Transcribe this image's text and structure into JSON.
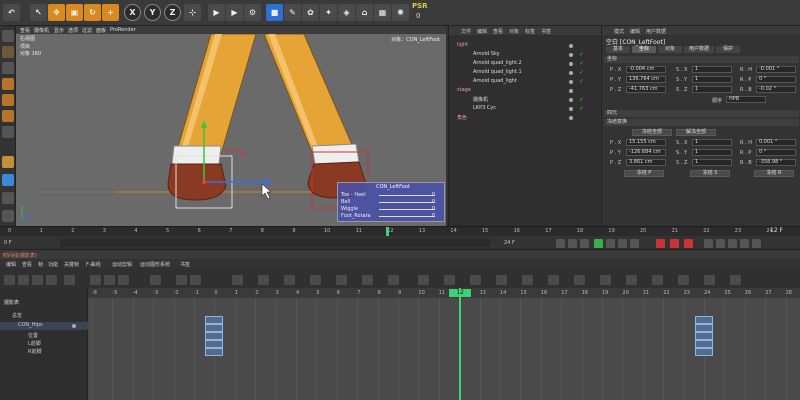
{
  "toolbar": {
    "axis_x": "X",
    "axis_y": "Y",
    "axis_z": "Z",
    "psr_label": "PSR",
    "psr_value": "0"
  },
  "viewport": {
    "menu": [
      "查看",
      "摄像机",
      "显示",
      "选项",
      "过滤",
      "面板",
      "ProRender"
    ],
    "corner_label": "右视图",
    "info_rows": [
      {
        "k": "项目",
        "v": ""
      },
      {
        "k": "对象",
        "v": "160"
      }
    ],
    "object_label": "对象：CON_LeftFoot",
    "controls": {
      "title": "CON_LeftFoot",
      "rows": [
        {
          "label": "Toe - Heel",
          "value": "0"
        },
        {
          "label": "Ball",
          "value": "0"
        },
        {
          "label": "Wiggle",
          "value": "0"
        },
        {
          "label": "Foot_Rotate",
          "value": "0"
        }
      ]
    }
  },
  "object_manager": {
    "menu": [
      "文件",
      "编辑",
      "查看",
      "对象",
      "标签",
      "书签"
    ],
    "items": [
      {
        "name": "light",
        "indent": 0
      },
      {
        "name": "Arnold Sky",
        "indent": 1
      },
      {
        "name": "Arnold quad_light.2",
        "indent": 1
      },
      {
        "name": "Arnold quad_light.1",
        "indent": 1
      },
      {
        "name": "Arnold quad_light",
        "indent": 1
      },
      {
        "name": "stage",
        "indent": 0
      },
      {
        "name": "摄像机",
        "indent": 1
      },
      {
        "name": "LKP3 Cyc",
        "indent": 1
      },
      {
        "name": "角色",
        "indent": 0
      }
    ]
  },
  "attribute_manager": {
    "menu": [
      "模式",
      "编辑",
      "用户数据"
    ],
    "title": "空白 [CON_LeftFoot]",
    "tabs": [
      "基本",
      "坐标",
      "对象",
      "用户数据",
      "保护"
    ],
    "section_coords": "坐标",
    "rows": [
      {
        "axis": "P . X",
        "p": "-0.004 cm",
        "saxis": "S . X",
        "s": "1",
        "raxis": "R . H",
        "r": "-0.001 °"
      },
      {
        "axis": "P . Y",
        "p": "136.764 cm",
        "saxis": "S . Y",
        "s": "1",
        "raxis": "R . P",
        "r": "0 °"
      },
      {
        "axis": "P . Z",
        "p": "-41.763 cm",
        "saxis": "S . Z",
        "s": "1",
        "raxis": "R . B",
        "r": "-0.02 °"
      }
    ],
    "order_label": "顺序",
    "order_value": "HPB",
    "section_quat": "四元",
    "section_freeze": "冻结变换",
    "freeze_all": "冻结全部",
    "unfreeze_all": "解冻全部",
    "frozen_rows": [
      {
        "axis": "P . X",
        "p": "15.155 cm",
        "saxis": "S . X",
        "s": "1",
        "raxis": "R . H",
        "r": "0.001 °"
      },
      {
        "axis": "P . Y",
        "p": "-126.684 cm",
        "saxis": "S . Y",
        "s": "1",
        "raxis": "R . P",
        "r": "0 °"
      },
      {
        "axis": "P . Z",
        "p": "3.861 cm",
        "saxis": "S . Z",
        "s": "1",
        "raxis": "R . B",
        "r": "-358.98 °"
      }
    ],
    "freeze_p": "冻结 P",
    "freeze_s": "冻结 S",
    "freeze_r": "冻结 R"
  },
  "timeline": {
    "ticks": [
      "0",
      "1",
      "2",
      "3",
      "4",
      "5",
      "6",
      "7",
      "8",
      "9",
      "10",
      "11",
      "12",
      "13",
      "14",
      "15",
      "16",
      "17",
      "18",
      "19",
      "20",
      "21",
      "22",
      "23",
      "24"
    ],
    "start": "0 F",
    "end_field": "24 F",
    "current": "12 F"
  },
  "dopesheet": {
    "title": "时间线(摄影表)",
    "menu": [
      "编辑",
      "查看",
      "帧",
      "功能",
      "关键帧",
      "F-曲线",
      "运动剪辑",
      "运动图形系统",
      "书签"
    ],
    "tree_title": "摄影表",
    "tree_items": [
      {
        "name": "总览",
        "indent": 0
      },
      {
        "name": "CON_Hips",
        "indent": 1
      },
      {
        "name": "位置",
        "indent": 2
      },
      {
        "name": "L前脚",
        "indent": 2
      },
      {
        "name": "R前脚",
        "indent": 2
      }
    ],
    "numbers": [
      "-6",
      "-5",
      "-4",
      "-3",
      "-2",
      "-1",
      "0",
      "1",
      "2",
      "3",
      "4",
      "5",
      "6",
      "7",
      "8",
      "9",
      "10",
      "11",
      "12",
      "13",
      "14",
      "15",
      "16",
      "17",
      "18",
      "19",
      "20",
      "21",
      "22",
      "23",
      "24",
      "25",
      "26",
      "27",
      "28",
      "29",
      "30"
    ],
    "current": "12"
  }
}
